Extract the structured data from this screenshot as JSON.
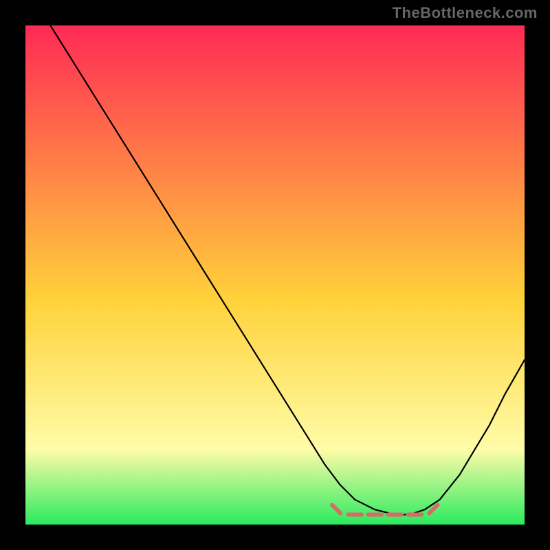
{
  "watermark": "TheBottleneck.com",
  "colors": {
    "gradient_top": "#ff2a55",
    "gradient_mid": "#ffd23a",
    "gradient_low": "#fffca8",
    "gradient_bottom": "#2bea5f",
    "curve": "#000000",
    "dash": "#d86a6a",
    "frame": "#000000"
  },
  "chart_data": {
    "type": "line",
    "title": "",
    "xlabel": "",
    "ylabel": "",
    "ylim": [
      0,
      100
    ],
    "xlim": [
      0,
      100
    ],
    "x": [
      5,
      10,
      15,
      20,
      25,
      30,
      35,
      40,
      45,
      50,
      55,
      60,
      63,
      66,
      70,
      74,
      77,
      80,
      83,
      87,
      90,
      93,
      96,
      100
    ],
    "values": [
      100,
      92,
      84,
      76,
      68,
      60,
      52,
      44,
      36,
      28,
      20,
      12,
      8,
      5,
      3,
      2,
      2,
      3,
      5,
      10,
      15,
      20,
      26,
      33
    ],
    "highlight_region": {
      "x_start": 62,
      "x_end": 82,
      "y": 2
    },
    "grid": false,
    "legend": false
  }
}
